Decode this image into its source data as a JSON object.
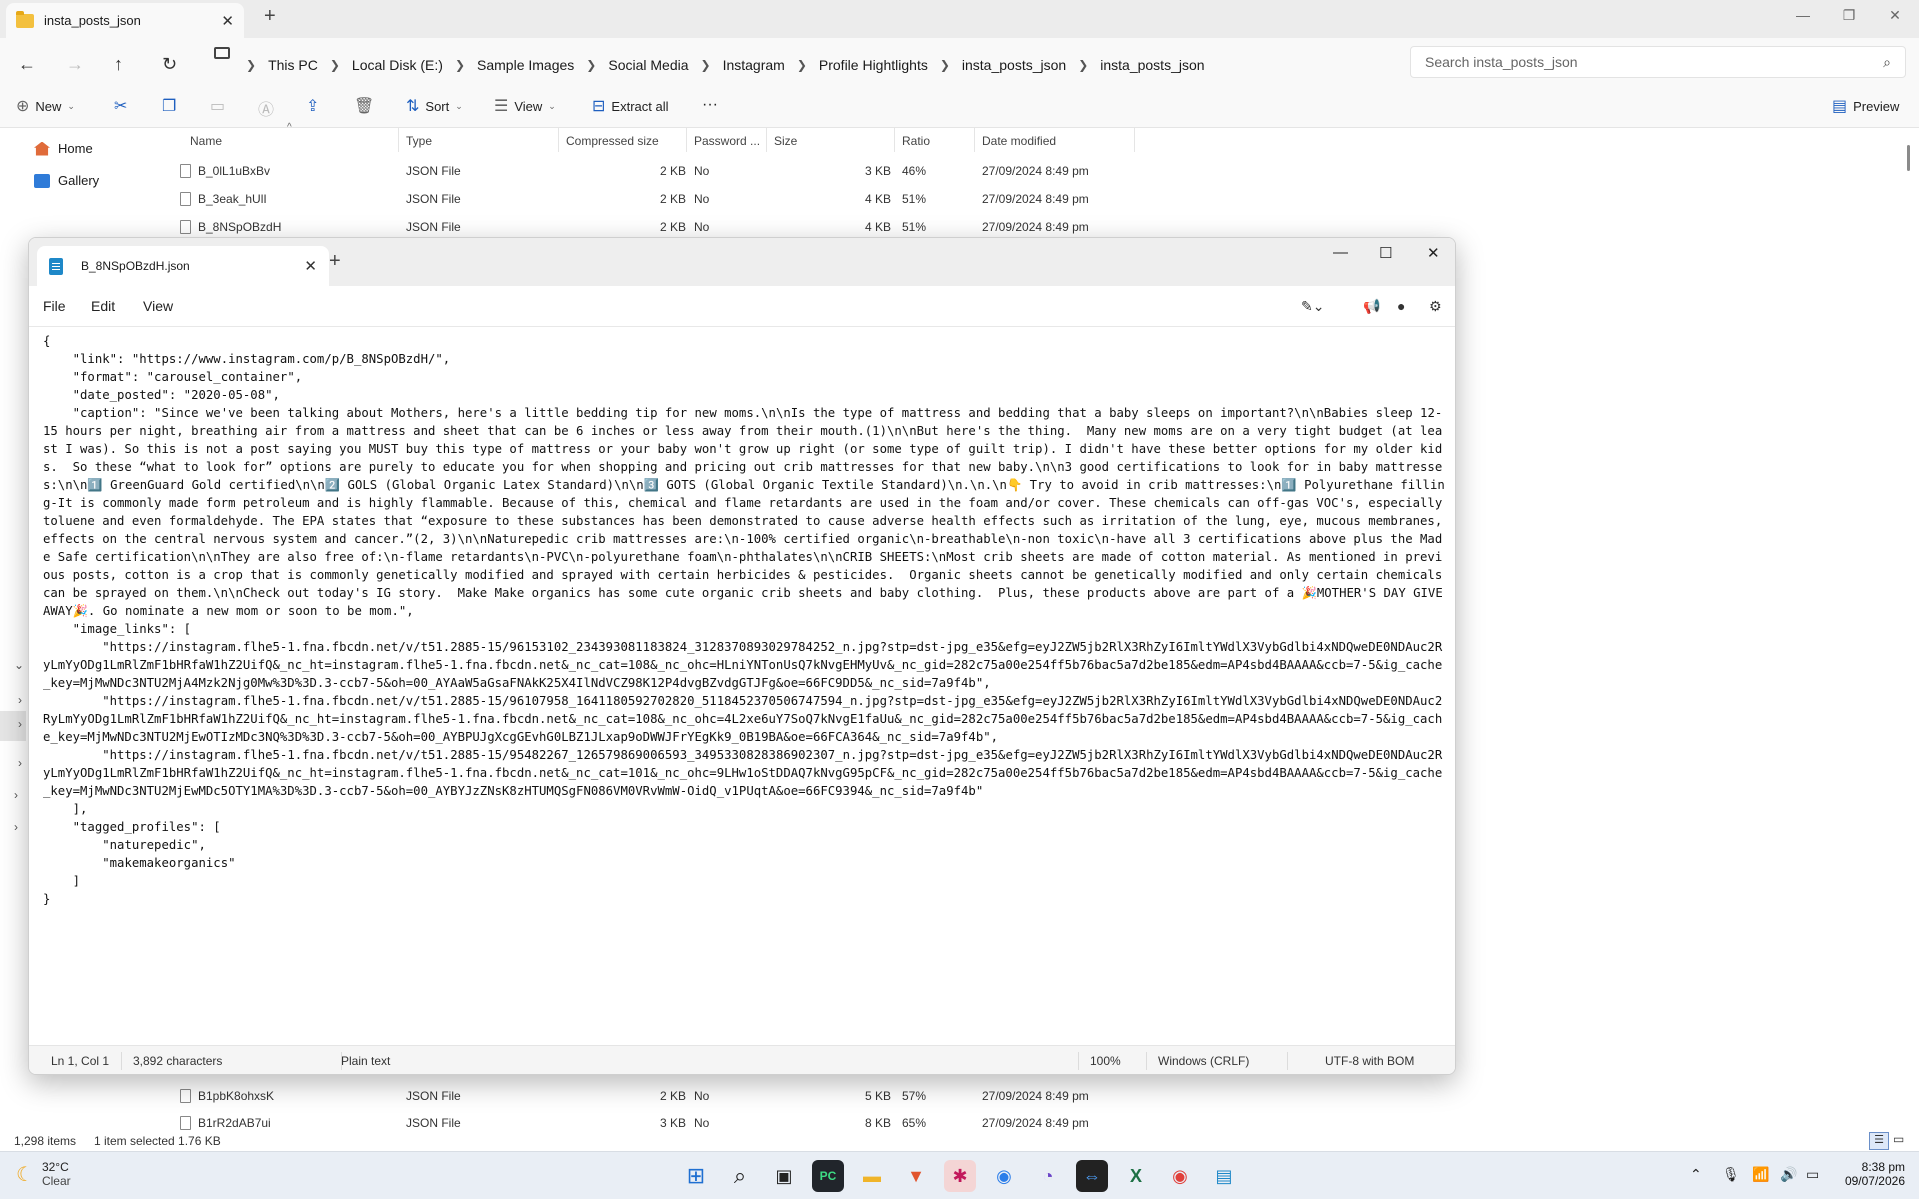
{
  "explorer": {
    "tab_title": "insta_posts_json",
    "breadcrumbs": [
      "This PC",
      "Local Disk (E:)",
      "Sample Images",
      "Social Media",
      "Instagram",
      "Profile Hightlights",
      "insta_posts_json",
      "insta_posts_json"
    ],
    "search_placeholder": "Search insta_posts_json",
    "toolbar": {
      "new": "New",
      "sort": "Sort",
      "view": "View",
      "extract_all": "Extract all",
      "more": "···",
      "preview": "Preview"
    },
    "nav": {
      "home": "Home",
      "gallery": "Gallery"
    },
    "columns": [
      "Name",
      "Type",
      "Compressed size",
      "Password ...",
      "Size",
      "Ratio",
      "Date modified"
    ],
    "rows_top": [
      {
        "name": "B_0lL1uBxBv",
        "type": "JSON File",
        "compressed": "2 KB",
        "password": "No",
        "size": "3 KB",
        "ratio": "46%",
        "date": "27/09/2024 8:49 pm"
      },
      {
        "name": "B_3eak_hUlI",
        "type": "JSON File",
        "compressed": "2 KB",
        "password": "No",
        "size": "4 KB",
        "ratio": "51%",
        "date": "27/09/2024 8:49 pm"
      },
      {
        "name": "B_8NSpOBzdH",
        "type": "JSON File",
        "compressed": "2 KB",
        "password": "No",
        "size": "4 KB",
        "ratio": "51%",
        "date": "27/09/2024 8:49 pm"
      }
    ],
    "rows_bottom": [
      {
        "name": "B1pbK8ohxsK",
        "type": "JSON File",
        "compressed": "2 KB",
        "password": "No",
        "size": "5 KB",
        "ratio": "57%",
        "date": "27/09/2024 8:49 pm"
      },
      {
        "name": "B1rR2dAB7ui",
        "type": "JSON File",
        "compressed": "3 KB",
        "password": "No",
        "size": "8 KB",
        "ratio": "65%",
        "date": "27/09/2024 8:49 pm"
      }
    ],
    "status": {
      "items": "1,298 items",
      "selected": "1 item selected  1.76 KB"
    }
  },
  "notepad": {
    "tab_title": "B_8NSpOBzdH.json",
    "menu": [
      "File",
      "Edit",
      "View"
    ],
    "content": "{\n    \"link\": \"https://www.instagram.com/p/B_8NSpOBzdH/\",\n    \"format\": \"carousel_container\",\n    \"date_posted\": \"2020-05-08\",\n    \"caption\": \"Since we've been talking about Mothers, here's a little bedding tip for new moms.\\n\\nIs the type of mattress and bedding that a baby sleeps on important?\\n\\nBabies sleep 12-15 hours per night, breathing air from a mattress and sheet that can be 6 inches or less away from their mouth.(1)\\n\\nBut here's the thing.  Many new moms are on a very tight budget (at least I was). So this is not a post saying you MUST buy this type of mattress or your baby won't grow up right (or some type of guilt trip). I didn't have these better options for my older kids.  So these “what to look for” options are purely to educate you for when shopping and pricing out crib mattresses for that new baby.\\n\\n3 good certifications to look for in baby mattresses:\\n\\n1️⃣ GreenGuard Gold certified\\n\\n2️⃣ GOLS (Global Organic Latex Standard)\\n\\n3️⃣ GOTS (Global Organic Textile Standard)\\n.\\n.\\n👇 Try to avoid in crib mattresses:\\n1️⃣ Polyurethane filling-It is commonly made form petroleum and is highly flammable. Because of this, chemical and flame retardants are used in the foam and/or cover. These chemicals can off-gas VOC's, especially toluene and even formaldehyde. The EPA states that “exposure to these substances has been demonstrated to cause adverse health effects such as irritation of the lung, eye, mucous membranes, effects on the central nervous system and cancer.”(2, 3)\\n\\nNaturepedic crib mattresses are:\\n-100% certified organic\\n-breathable\\n-non toxic\\n-have all 3 certifications above plus the Made Safe certification\\n\\nThey are also free of:\\n-flame retardants\\n-PVC\\n-polyurethane foam\\n-phthalates\\n\\nCRIB SHEETS:\\nMost crib sheets are made of cotton material. As mentioned in previous posts, cotton is a crop that is commonly genetically modified and sprayed with certain herbicides & pesticides.  Organic sheets cannot be genetically modified and only certain chemicals can be sprayed on them.\\n\\nCheck out today's IG story.  Make Make organics has some cute organic crib sheets and baby clothing.  Plus, these products above are part of a 🎉MOTHER'S DAY GIVEAWAY🎉. Go nominate a new mom or soon to be mom.\",\n    \"image_links\": [\n        \"https://instagram.flhe5-1.fna.fbcdn.net/v/t51.2885-15/96153102_234393081183824_3128370893029784252_n.jpg?stp=dst-jpg_e35&efg=eyJ2ZW5jb2RlX3RhZyI6ImltYWdlX3VybGdlbi4xNDQweDE0NDAuc2RyLmYyODg1LmRlZmF1bHRfaW1hZ2UifQ&_nc_ht=instagram.flhe5-1.fna.fbcdn.net&_nc_cat=108&_nc_ohc=HLniYNTonUsQ7kNvgEHMyUv&_nc_gid=282c75a00e254ff5b76bac5a7d2be185&edm=AP4sbd4BAAAA&ccb=7-5&ig_cache_key=MjMwNDc3NTU2MjA4Mzk2Njg0Mw%3D%3D.3-ccb7-5&oh=00_AYAaW5aGsaFNAkK25X4IlNdVCZ98K12P4dvgBZvdgGTJFg&oe=66FC9DD5&_nc_sid=7a9f4b\",\n        \"https://instagram.flhe5-1.fna.fbcdn.net/v/t51.2885-15/96107958_1641180592702820_5118452370506747594_n.jpg?stp=dst-jpg_e35&efg=eyJ2ZW5jb2RlX3RhZyI6ImltYWdlX3VybGdlbi4xNDQweDE0NDAuc2RyLmYyODg1LmRlZmF1bHRfaW1hZ2UifQ&_nc_ht=instagram.flhe5-1.fna.fbcdn.net&_nc_cat=108&_nc_ohc=4L2xe6uY7SoQ7kNvgE1faUu&_nc_gid=282c75a00e254ff5b76bac5a7d2be185&edm=AP4sbd4BAAAA&ccb=7-5&ig_cache_key=MjMwNDc3NTU2MjEwOTIzMDc3NQ%3D%3D.3-ccb7-5&oh=00_AYBPUJgXcgGEvhG0LBZ1JLxap9oDWWJFrYEgKk9_0B19BA&oe=66FCA364&_nc_sid=7a9f4b\",\n        \"https://instagram.flhe5-1.fna.fbcdn.net/v/t51.2885-15/95482267_126579869006593_3495330828386902307_n.jpg?stp=dst-jpg_e35&efg=eyJ2ZW5jb2RlX3RhZyI6ImltYWdlX3VybGdlbi4xNDQweDE0NDAuc2RyLmYyODg1LmRlZmF1bHRfaW1hZ2UifQ&_nc_ht=instagram.flhe5-1.fna.fbcdn.net&_nc_cat=101&_nc_ohc=9LHw1oStDDAQ7kNvgG95pCF&_nc_gid=282c75a00e254ff5b76bac5a7d2be185&edm=AP4sbd4BAAAA&ccb=7-5&ig_cache_key=MjMwNDc3NTU2MjEwMDc5OTY1MA%3D%3D.3-ccb7-5&oh=00_AYBYJzZNsK8zHTUMQSgFN086VM0VRvWmW-OidQ_v1PUqtA&oe=66FC9394&_nc_sid=7a9f4b\"\n    ],\n    \"tagged_profiles\": [\n        \"naturepedic\",\n        \"makemakeorganics\"\n    ]\n}",
    "status": {
      "position": "Ln 1, Col 1",
      "chars": "3,892 characters",
      "mode": "Plain text",
      "zoom": "100%",
      "line_ending": "Windows (CRLF)",
      "encoding": "UTF-8 with BOM"
    }
  },
  "taskbar": {
    "temp": "32°C",
    "condition": "Clear",
    "time": "8:38 pm",
    "date": "09/07/2026"
  }
}
